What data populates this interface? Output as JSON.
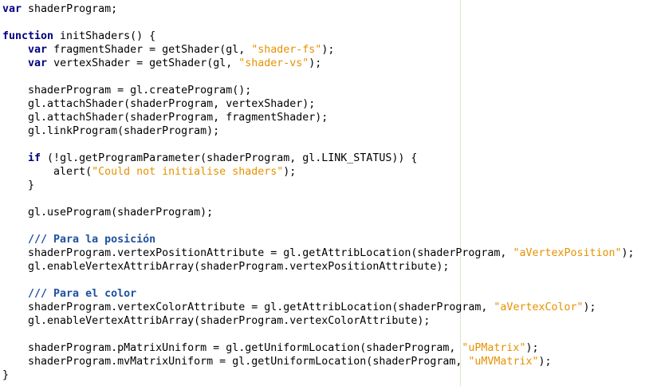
{
  "editor": {
    "lines": [
      [
        {
          "t": "var",
          "c": "kw"
        },
        {
          "t": " shaderProgram;",
          "c": ""
        }
      ],
      [],
      [
        {
          "t": "function",
          "c": "kw"
        },
        {
          "t": " initShaders() {",
          "c": ""
        }
      ],
      [
        {
          "t": "    ",
          "c": ""
        },
        {
          "t": "var",
          "c": "kw"
        },
        {
          "t": " fragmentShader = getShader(gl, ",
          "c": ""
        },
        {
          "t": "\"shader-fs\"",
          "c": "str"
        },
        {
          "t": ");",
          "c": ""
        }
      ],
      [
        {
          "t": "    ",
          "c": ""
        },
        {
          "t": "var",
          "c": "kw"
        },
        {
          "t": " vertexShader = getShader(gl, ",
          "c": ""
        },
        {
          "t": "\"shader-vs\"",
          "c": "str"
        },
        {
          "t": ");",
          "c": ""
        }
      ],
      [],
      [
        {
          "t": "    shaderProgram = gl.createProgram();",
          "c": ""
        }
      ],
      [
        {
          "t": "    gl.attachShader(shaderProgram, vertexShader);",
          "c": ""
        }
      ],
      [
        {
          "t": "    gl.attachShader(shaderProgram, fragmentShader);",
          "c": ""
        }
      ],
      [
        {
          "t": "    gl.linkProgram(shaderProgram);",
          "c": ""
        }
      ],
      [],
      [
        {
          "t": "    ",
          "c": ""
        },
        {
          "t": "if",
          "c": "kw"
        },
        {
          "t": " (!gl.getProgramParameter(shaderProgram, gl.LINK_STATUS)) {",
          "c": ""
        }
      ],
      [
        {
          "t": "        alert(",
          "c": ""
        },
        {
          "t": "\"Could not initialise shaders\"",
          "c": "str"
        },
        {
          "t": ");",
          "c": ""
        }
      ],
      [
        {
          "t": "    }",
          "c": ""
        }
      ],
      [],
      [
        {
          "t": "    gl.useProgram(shaderProgram);",
          "c": ""
        }
      ],
      [],
      [
        {
          "t": "    /// Para la posición",
          "c": "cmt-bold"
        }
      ],
      [
        {
          "t": "    shaderProgram.vertexPositionAttribute = gl.getAttribLocation(shaderProgram, ",
          "c": ""
        },
        {
          "t": "\"aVertexPosition\"",
          "c": "str"
        },
        {
          "t": ");",
          "c": ""
        }
      ],
      [
        {
          "t": "    gl.enableVertexAttribArray(shaderProgram.vertexPositionAttribute);",
          "c": ""
        }
      ],
      [],
      [
        {
          "t": "    /// Para el color",
          "c": "cmt-bold"
        }
      ],
      [
        {
          "t": "    shaderProgram.vertexColorAttribute = gl.getAttribLocation(shaderProgram, ",
          "c": ""
        },
        {
          "t": "\"aVertexColor\"",
          "c": "str"
        },
        {
          "t": ");",
          "c": ""
        }
      ],
      [
        {
          "t": "    gl.enableVertexAttribArray(shaderProgram.vertexColorAttribute);",
          "c": ""
        }
      ],
      [],
      [
        {
          "t": "    shaderProgram.pMatrixUniform = gl.getUniformLocation(shaderProgram, ",
          "c": ""
        },
        {
          "t": "\"uPMatrix\"",
          "c": "str"
        },
        {
          "t": ");",
          "c": ""
        }
      ],
      [
        {
          "t": "    shaderProgram.mvMatrixUniform = gl.getUniformLocation(shaderProgram, ",
          "c": ""
        },
        {
          "t": "\"uMVMatrix\"",
          "c": "str"
        },
        {
          "t": ");",
          "c": ""
        }
      ],
      [
        {
          "t": "}",
          "c": ""
        }
      ]
    ]
  }
}
